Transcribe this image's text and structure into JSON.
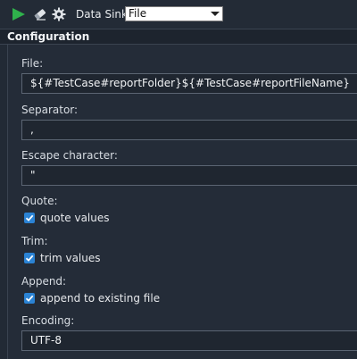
{
  "toolbar": {
    "icons": [
      "run-icon",
      "eraser-icon",
      "gear-icon"
    ],
    "sink_label": "Data Sink:",
    "sink_value": "File"
  },
  "section": {
    "title": "Configuration"
  },
  "fields": {
    "file": {
      "label": "File:",
      "value": "${#TestCase#reportFolder}${#TestCase#reportFileName}"
    },
    "separator": {
      "label": "Separator:",
      "value": ","
    },
    "escape": {
      "label": "Escape character:",
      "value": "\""
    },
    "quote": {
      "label": "Quote:",
      "checkbox_label": "quote values",
      "checked": true
    },
    "trim": {
      "label": "Trim:",
      "checkbox_label": "trim values",
      "checked": true
    },
    "append": {
      "label": "Append:",
      "checkbox_label": "append to existing file",
      "checked": true
    },
    "encoding": {
      "label": "Encoding:",
      "value": "UTF-8"
    }
  },
  "colors": {
    "accent": "#2b83d4",
    "run_green": "#2fb24c",
    "background": "#222a35"
  }
}
